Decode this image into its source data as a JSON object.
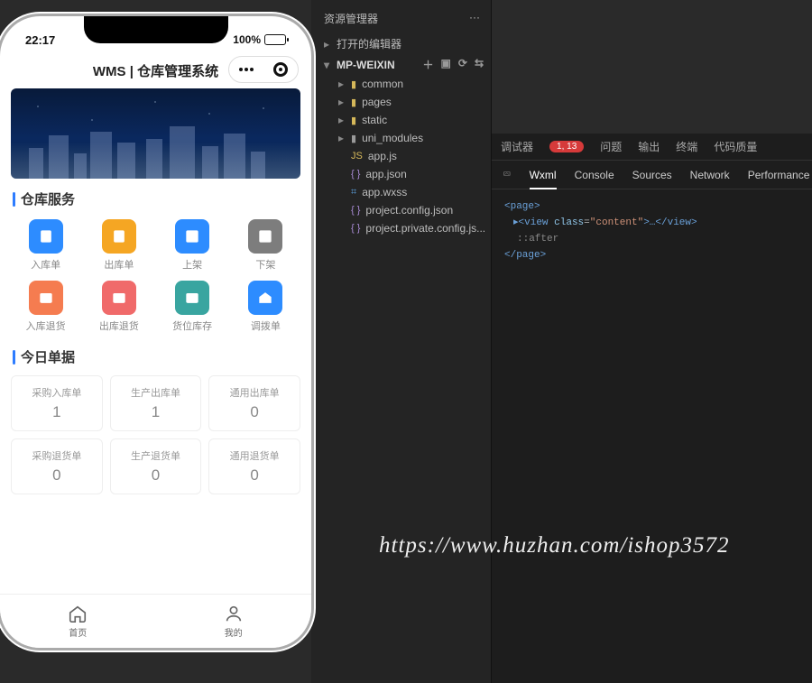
{
  "phone": {
    "time": "22:17",
    "battery": "100%",
    "title": "WMS | 仓库管理系统",
    "section_services": "仓库服务",
    "section_today": "今日单据",
    "services": [
      {
        "label": "入库单"
      },
      {
        "label": "出库单"
      },
      {
        "label": "上架"
      },
      {
        "label": "下架"
      },
      {
        "label": "入库退货"
      },
      {
        "label": "出库退货"
      },
      {
        "label": "货位库存"
      },
      {
        "label": "调拨单"
      }
    ],
    "cards": [
      {
        "t": "采购入库单",
        "n": "1"
      },
      {
        "t": "生产出库单",
        "n": "1"
      },
      {
        "t": "通用出库单",
        "n": "0"
      },
      {
        "t": "采购退货单",
        "n": "0"
      },
      {
        "t": "生产退货单",
        "n": "0"
      },
      {
        "t": "通用退货单",
        "n": "0"
      }
    ],
    "tabs": {
      "home": "首页",
      "mine": "我的"
    }
  },
  "explorer": {
    "title": "资源管理器",
    "open_editors": "打开的编辑器",
    "project": "MP-WEIXIN",
    "folders": [
      "common",
      "pages",
      "static",
      "uni_modules"
    ],
    "files": [
      "app.js",
      "app.json",
      "app.wxss",
      "project.config.json",
      "project.private.config.js..."
    ]
  },
  "devtools": {
    "tabs": {
      "debug": "调试器",
      "badge": "1, 13",
      "issues": "问题",
      "output": "输出",
      "terminal": "终端",
      "quality": "代码质量"
    },
    "sub": [
      "Wxml",
      "Console",
      "Sources",
      "Network",
      "Performance"
    ],
    "code": {
      "l1": "<page>",
      "l2a": "▸<view ",
      "l2cls": "class",
      "l2val": "\"content\"",
      "l2b": ">…</view>",
      "l3": "::after",
      "l4": "</page>"
    }
  },
  "watermark": "https://www.huzhan.com/ishop3572"
}
